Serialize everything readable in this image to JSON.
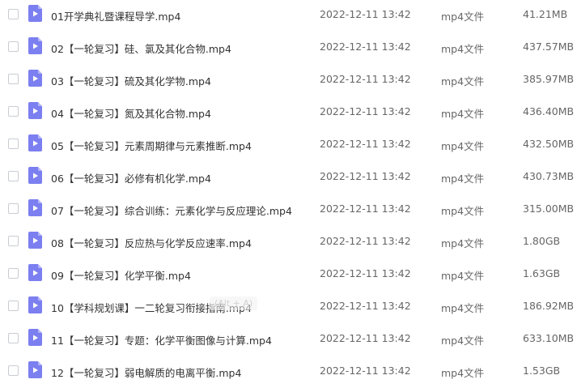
{
  "accent_color": "#7c7ff0",
  "files": [
    {
      "name": "01开学典礼暨课程导学.mp4",
      "date": "2022-12-11 13:42",
      "type": "mp4文件",
      "size": "41.21MB",
      "icon": "video-file-icon"
    },
    {
      "name": "02【一轮复习】硅、氯及其化合物.mp4",
      "date": "2022-12-11 13:42",
      "type": "mp4文件",
      "size": "437.57MB",
      "icon": "video-file-icon"
    },
    {
      "name": "03【一轮复习】硫及其化学物.mp4",
      "date": "2022-12-11 13:42",
      "type": "mp4文件",
      "size": "385.97MB",
      "icon": "video-file-icon"
    },
    {
      "name": "04【一轮复习】氮及其化合物.mp4",
      "date": "2022-12-11 13:42",
      "type": "mp4文件",
      "size": "436.40MB",
      "icon": "video-file-icon"
    },
    {
      "name": "05【一轮复习】元素周期律与元素推断.mp4",
      "date": "2022-12-11 13:42",
      "type": "mp4文件",
      "size": "432.50MB",
      "icon": "video-file-icon"
    },
    {
      "name": "06【一轮复习】必修有机化学.mp4",
      "date": "2022-12-11 13:42",
      "type": "mp4文件",
      "size": "430.73MB",
      "icon": "video-file-icon"
    },
    {
      "name": "07【一轮复习】综合训练：元素化学与反应理论.mp4",
      "date": "2022-12-11 13:42",
      "type": "mp4文件",
      "size": "315.00MB",
      "icon": "video-file-icon"
    },
    {
      "name": "08【一轮复习】反应热与化学反应速率.mp4",
      "date": "2022-12-11 13:42",
      "type": "mp4文件",
      "size": "1.80GB",
      "icon": "video-file-icon"
    },
    {
      "name": "09【一轮复习】化学平衡.mp4",
      "date": "2022-12-11 13:42",
      "type": "mp4文件",
      "size": "1.63GB",
      "icon": "video-file-icon"
    },
    {
      "name": "10【学科规划课】一二轮复习衔接指南.mp4",
      "date": "2022-12-11 13:42",
      "type": "mp4文件",
      "size": "186.92MB",
      "icon": "video-file-icon"
    },
    {
      "name": "11【一轮复习】专题：化学平衡图像与计算.mp4",
      "date": "2022-12-11 13:42",
      "type": "mp4文件",
      "size": "633.10MB",
      "icon": "video-file-icon"
    },
    {
      "name": "12【一轮复习】弱电解质的电离平衡.mp4",
      "date": "2022-12-11 13:42",
      "type": "mp4文件",
      "size": "1.53GB",
      "icon": "video-file-icon"
    }
  ],
  "shortcut_hint": "(Alt + A)"
}
